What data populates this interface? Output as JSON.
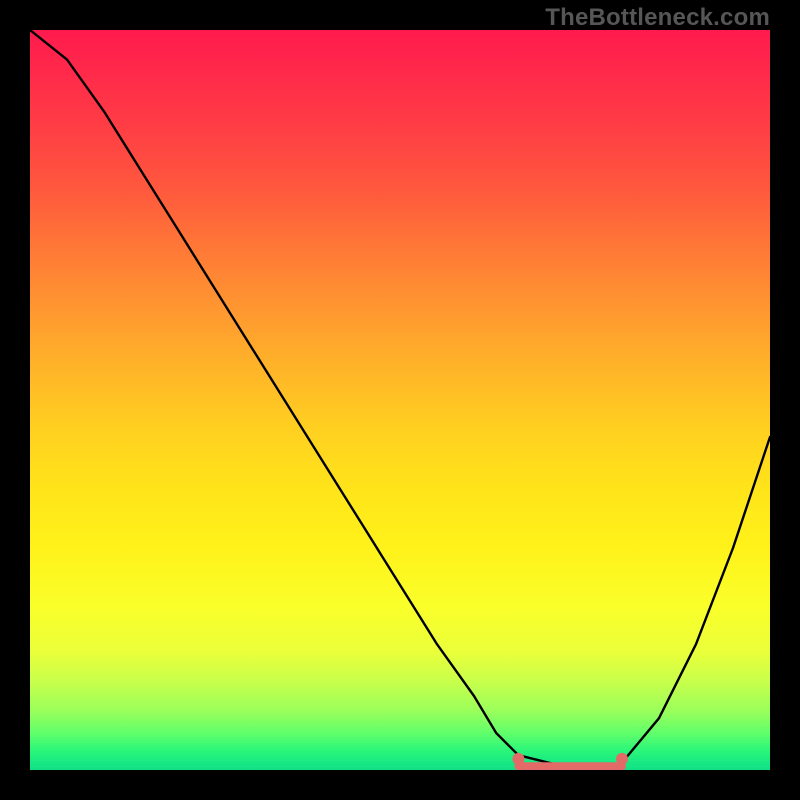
{
  "watermark": "TheBottleneck.com",
  "chart_data": {
    "type": "line",
    "title": "",
    "xlabel": "",
    "ylabel": "",
    "x_range": [
      0,
      100
    ],
    "y_range": [
      0,
      100
    ],
    "series": [
      {
        "name": "bottleneck-curve",
        "x": [
          0,
          5,
          10,
          15,
          20,
          25,
          30,
          35,
          40,
          45,
          50,
          55,
          60,
          63,
          66,
          70,
          74,
          78,
          80,
          85,
          90,
          95,
          100
        ],
        "y": [
          100,
          96,
          89,
          81,
          73,
          65,
          57,
          49,
          41,
          33,
          25,
          17,
          10,
          5,
          2,
          1,
          0,
          0,
          1,
          7,
          17,
          30,
          45
        ]
      }
    ],
    "flat_region": {
      "x_start": 66,
      "x_end": 80,
      "y": 0.5
    },
    "markers": [
      {
        "x": 66,
        "y": 1.5,
        "name": "flat-start-marker"
      },
      {
        "x": 80,
        "y": 1.5,
        "name": "flat-end-marker"
      }
    ],
    "colors": {
      "curve": "#000000",
      "flat_line": "#e26b68",
      "marker": "#e26b68",
      "gradient_top": "#ff1a4d",
      "gradient_bottom": "#10e086"
    }
  }
}
